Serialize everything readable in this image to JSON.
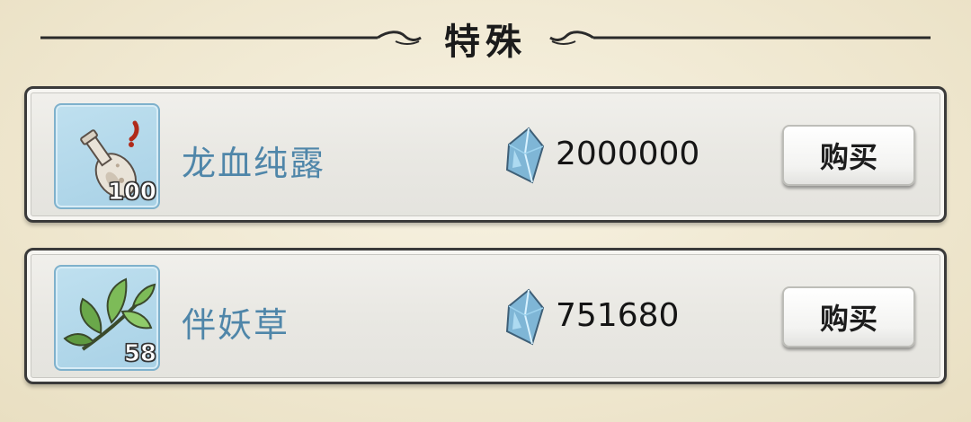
{
  "section": {
    "title": "特殊"
  },
  "items": [
    {
      "name": "龙血纯露",
      "count": "100",
      "icon": "dragon-blood-vial-icon",
      "price": "2000000",
      "currency_icon": "crystal-icon",
      "buy_label": "购买"
    },
    {
      "name": "伴妖草",
      "count": "58",
      "icon": "herb-leaf-icon",
      "price": "751680",
      "currency_icon": "crystal-icon",
      "buy_label": "购买"
    }
  ],
  "colors": {
    "item_name": "#4f86a9",
    "icon_bg": "#a8d1e6",
    "background": "#efe7cf"
  }
}
